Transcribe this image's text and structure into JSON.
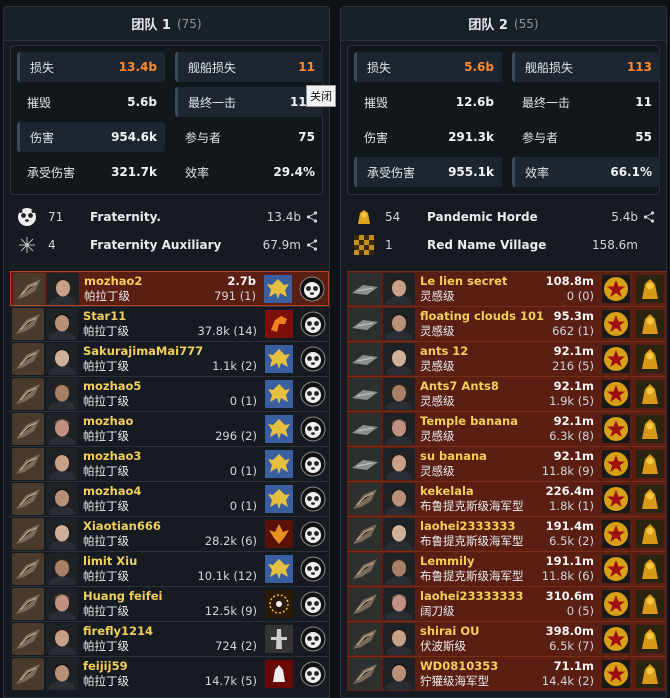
{
  "tooltip": "关闭",
  "teams": [
    {
      "name": "团队 1",
      "count": "(75)",
      "stats": {
        "loss_label": "损失",
        "loss_value": "13.4b",
        "ship_loss_label": "舰船损失",
        "ship_loss_value": "11",
        "destroy_label": "摧毁",
        "destroy_value": "5.6b",
        "final_blow_label": "最终一击",
        "final_blow_value": "112",
        "damage_label": "伤害",
        "damage_value": "954.6k",
        "participants_label": "参与者",
        "participants_value": "75",
        "damage_taken_label": "承受伤害",
        "damage_taken_value": "321.7k",
        "efficiency_label": "效率",
        "efficiency_value": "29.4%"
      },
      "alliances": [
        {
          "count": "71",
          "name": "Fraternity.",
          "value": "13.4b",
          "icon": "panda-logo-icon"
        },
        {
          "count": "4",
          "name": "Fraternity Auxiliary",
          "value": "67.9m",
          "icon": "star-burst-icon"
        }
      ],
      "rows": [
        {
          "pilot": "mozhao2",
          "value": "2.7b",
          "ship": "帕拉丁级",
          "sub": "791 (1)",
          "corp": "eagle-logo-icon",
          "highlight": true
        },
        {
          "pilot": "Star11",
          "value": "",
          "ship": "帕拉丁级",
          "sub": "37.8k (14)",
          "corp": "horse-logo-icon"
        },
        {
          "pilot": "SakurajimaMai777",
          "value": "",
          "ship": "帕拉丁级",
          "sub": "1.1k (2)",
          "corp": "eagle-logo-icon"
        },
        {
          "pilot": "mozhao5",
          "value": "",
          "ship": "帕拉丁级",
          "sub": "0 (1)",
          "corp": "eagle-logo-icon"
        },
        {
          "pilot": "mozhao",
          "value": "",
          "ship": "帕拉丁级",
          "sub": "296 (2)",
          "corp": "eagle-logo-icon"
        },
        {
          "pilot": "mozhao3",
          "value": "",
          "ship": "帕拉丁级",
          "sub": "0 (1)",
          "corp": "eagle-logo-icon"
        },
        {
          "pilot": "mozhao4",
          "value": "",
          "ship": "帕拉丁级",
          "sub": "0 (1)",
          "corp": "eagle-logo-icon"
        },
        {
          "pilot": "Xiaotian666",
          "value": "",
          "ship": "帕拉丁级",
          "sub": "28.2k (6)",
          "corp": "phoenix-logo-icon"
        },
        {
          "pilot": "limit Xiu",
          "value": "",
          "ship": "帕拉丁级",
          "sub": "10.1k (12)",
          "corp": "eagle-logo-icon"
        },
        {
          "pilot": "Huang feifei",
          "value": "",
          "ship": "帕拉丁级",
          "sub": "12.5k (9)",
          "corp": "stars-circle-logo-icon"
        },
        {
          "pilot": "firefly1214",
          "value": "",
          "ship": "帕拉丁级",
          "sub": "724 (2)",
          "corp": "tower-logo-icon"
        },
        {
          "pilot": "feijij59",
          "value": "",
          "ship": "帕拉丁级",
          "sub": "14.7k (5)",
          "corp": "wolf-logo-icon"
        }
      ]
    },
    {
      "name": "团队 2",
      "count": "(55)",
      "stats": {
        "loss_label": "损失",
        "loss_value": "5.6b",
        "ship_loss_label": "舰船损失",
        "ship_loss_value": "113",
        "destroy_label": "摧毁",
        "destroy_value": "12.6b",
        "final_blow_label": "最终一击",
        "final_blow_value": "11",
        "damage_label": "伤害",
        "damage_value": "291.3k",
        "participants_label": "参与者",
        "participants_value": "55",
        "damage_taken_label": "承受伤害",
        "damage_taken_value": "955.1k",
        "efficiency_label": "效率",
        "efficiency_value": "66.1%"
      },
      "alliances": [
        {
          "count": "54",
          "name": "Pandemic Horde",
          "value": "5.4b",
          "icon": "horde-logo-icon"
        },
        {
          "count": "1",
          "name": "Red Name Village",
          "value": "158.6m",
          "icon": "checker-logo-icon"
        }
      ],
      "rows": [
        {
          "pilot": "Le lien secret",
          "value": "108.8m",
          "ship": "灵感级",
          "sub": "0 (0)",
          "flag": "yellow"
        },
        {
          "pilot": "floating clouds 101",
          "value": "95.3m",
          "ship": "灵感级",
          "sub": "662 (1)",
          "flag": "yellow"
        },
        {
          "pilot": "ants 12",
          "value": "92.1m",
          "ship": "灵感级",
          "sub": "216 (5)",
          "flag": "yellow"
        },
        {
          "pilot": "Ants7 Ants8",
          "value": "92.1m",
          "ship": "灵感级",
          "sub": "1.9k (5)",
          "flag": "yellow"
        },
        {
          "pilot": "Temple banana",
          "value": "92.1m",
          "ship": "灵感级",
          "sub": "6.3k (8)",
          "flag": "yellow"
        },
        {
          "pilot": "su banana",
          "value": "92.1m",
          "ship": "灵感级",
          "sub": "11.8k (9)",
          "flag": "yellow"
        },
        {
          "pilot": "kekelala",
          "value": "226.4m",
          "ship": "布鲁提克斯级海军型",
          "sub": "1.8k (1)",
          "flag": "green"
        },
        {
          "pilot": "laohei2333333",
          "value": "191.4m",
          "ship": "布鲁提克斯级海军型",
          "sub": "6.5k (2)",
          "flag": "green"
        },
        {
          "pilot": "Lemmily",
          "value": "191.1m",
          "ship": "布鲁提克斯级海军型",
          "sub": "11.8k (6)",
          "flag": "green"
        },
        {
          "pilot": "laohei23333333",
          "value": "310.6m",
          "ship": "阔刀级",
          "sub": "0 (5)",
          "flag": "green"
        },
        {
          "pilot": "shirai OU",
          "value": "398.0m",
          "ship": "伏波斯级",
          "sub": "6.5k (7)",
          "flag": "green"
        },
        {
          "pilot": "WD0810353",
          "value": "71.1m",
          "ship": "狞獾级海军型",
          "sub": "14.4k (2)",
          "flag": "green"
        }
      ]
    }
  ]
}
